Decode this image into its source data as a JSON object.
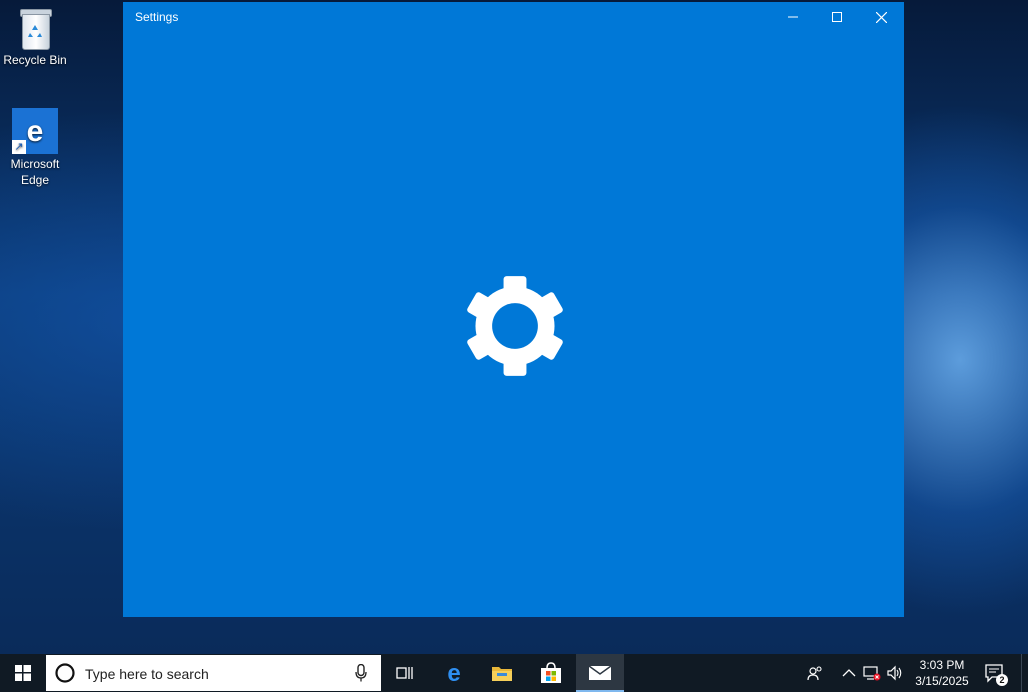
{
  "desktop": {
    "icons": [
      {
        "label": "Recycle Bin",
        "icon": "recycle-bin-icon"
      },
      {
        "label": "Microsoft Edge",
        "icon": "edge-icon"
      }
    ]
  },
  "window": {
    "title": "Settings",
    "controls": {
      "minimize": "minimize-icon",
      "maximize": "maximize-icon",
      "close": "close-icon"
    },
    "splash_icon": "gear-icon",
    "background_color": "#0078d7"
  },
  "taskbar": {
    "search_placeholder": "Type here to search",
    "pinned": [
      "task-view-icon",
      "edge-icon",
      "file-explorer-icon",
      "store-icon",
      "mail-icon"
    ],
    "active_app": "mail-icon",
    "clock": {
      "time": "3:03 PM",
      "date": "3/15/2025"
    },
    "notifications_count": "2"
  },
  "colors": {
    "accent": "#0078d7",
    "taskbar": "#101a24"
  }
}
